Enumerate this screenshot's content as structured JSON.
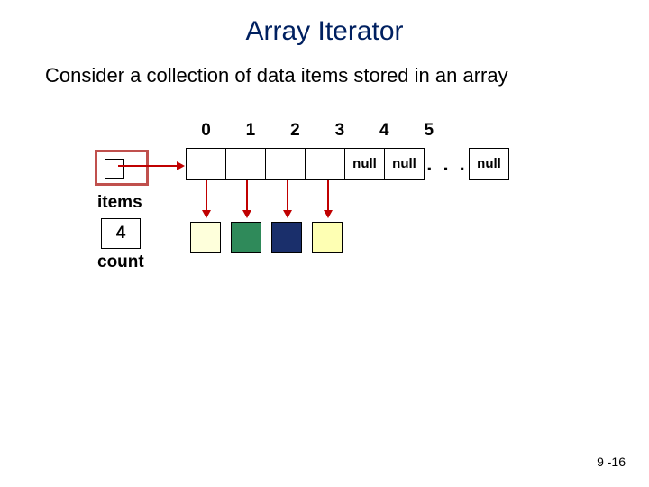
{
  "title": "Array Iterator",
  "subtitle": "Consider a collection of data items stored in an array",
  "diagram": {
    "items_label": "items",
    "count_label": "count",
    "count_value": "4",
    "indices": [
      "0",
      "1",
      "2",
      "3",
      "4",
      "5"
    ],
    "cells": [
      "",
      "",
      "",
      "",
      "null",
      "null"
    ],
    "ellipsis": ". . .",
    "last_cell": "null",
    "data_colors": [
      "#feffdb",
      "#2f8a5a",
      "#1a2f6b",
      "#feffb3"
    ]
  },
  "slide_number": "9 -16"
}
